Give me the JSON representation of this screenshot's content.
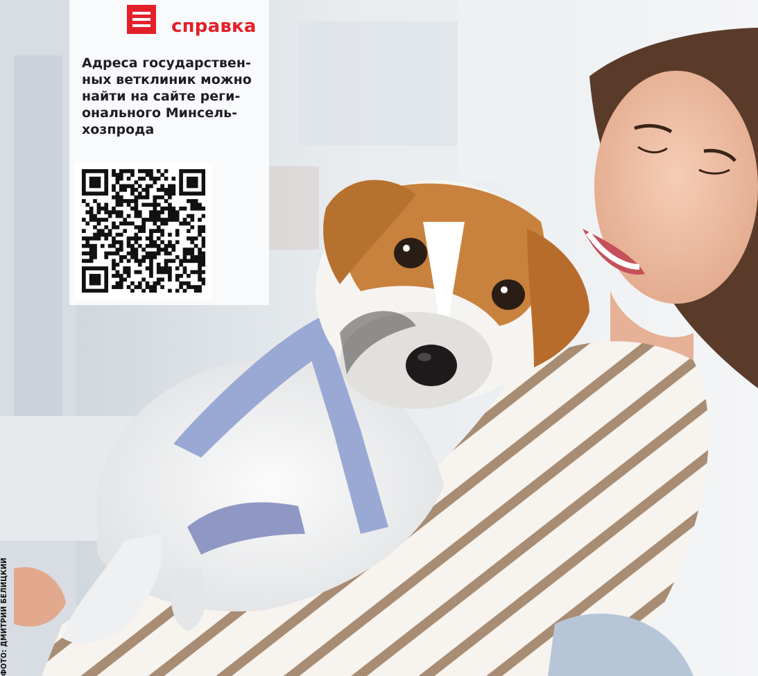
{
  "infobox": {
    "header_icon": "menu-lines-icon",
    "header_label": "справка",
    "body_text": "Адреса государствен-\nных ветклиник можно\nнайти на сайте реги-\nонального Минсель-\nхозпрода",
    "accent_color": "#e3202a"
  },
  "photo_credit": "ФОТО: ДМИТРИЙ БЕЛИЦКИЙ"
}
